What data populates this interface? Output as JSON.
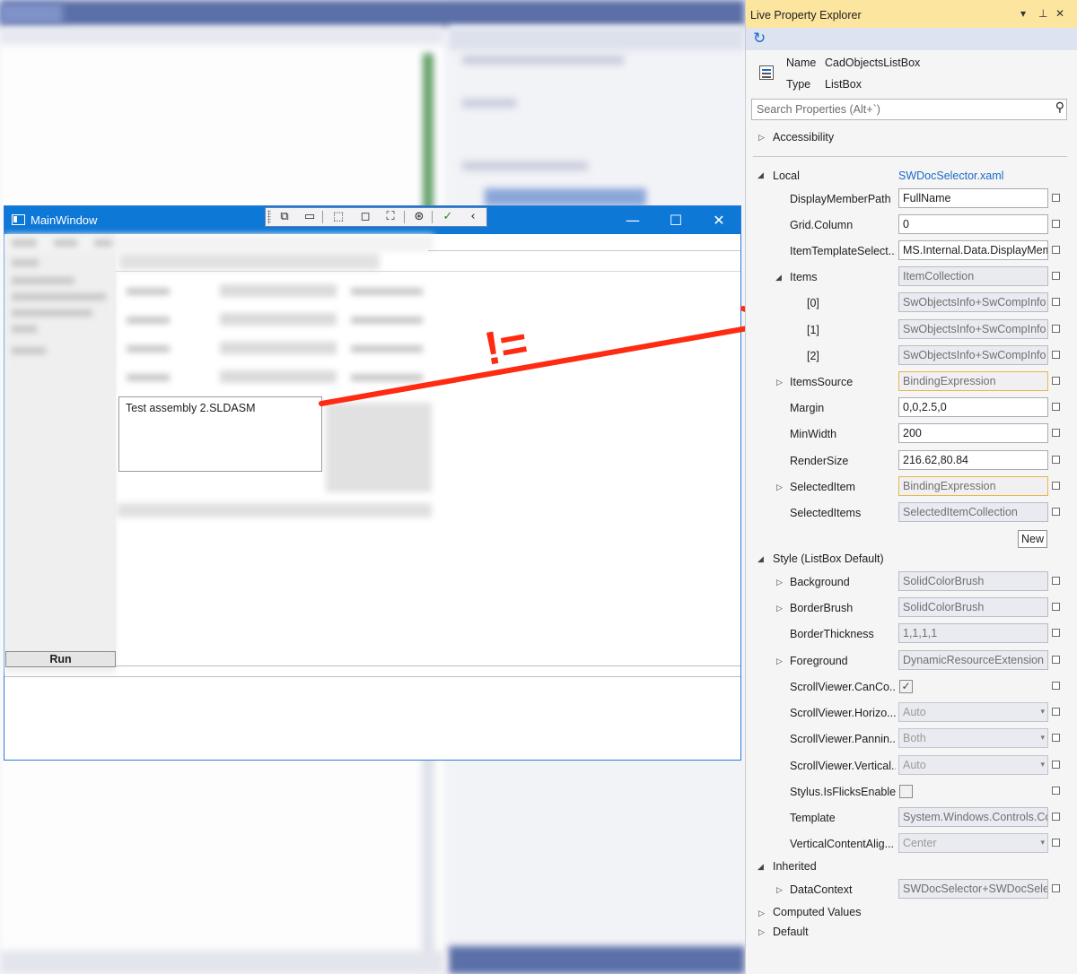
{
  "main_window": {
    "title": "MainWindow",
    "listbox_items": [
      "Test assembly 2.SLDASM"
    ],
    "run_label": "Run",
    "caption_buttons": {
      "minimize": "—",
      "maximize": "☐",
      "close": "✕"
    },
    "toolbar_icons": [
      "select-element-icon",
      "display-adorners-icon",
      "select-icon",
      "layout-adorner-icon",
      "track-focus-icon",
      "binding-failures-icon",
      "hot-reload-ok-icon",
      "collapse-icon"
    ]
  },
  "annotation": {
    "text": "!=",
    "color": "#ff2a12"
  },
  "live_property_explorer": {
    "title": "Live Property Explorer",
    "title_buttons": {
      "dropdown": "▾",
      "pin": "⊥",
      "close": "✕"
    },
    "header": {
      "name_label": "Name",
      "name_value": "CadObjectsListBox",
      "type_label": "Type",
      "type_value": "ListBox"
    },
    "search_placeholder": "Search Properties (Alt+`)",
    "sections": {
      "accessibility": "Accessibility",
      "local": "Local",
      "local_source": "SWDocSelector.xaml",
      "style": "Style (ListBox Default)",
      "inherited": "Inherited",
      "computed": "Computed Values",
      "default": "Default"
    },
    "local_props": [
      {
        "label": "DisplayMemberPath",
        "value": "FullName"
      },
      {
        "label": "Grid.Column",
        "value": "0"
      },
      {
        "label": "ItemTemplateSelect...",
        "value": "MS.Internal.Data.DisplayMemberTemplateSelector"
      },
      {
        "label": "Items",
        "value": "ItemCollection"
      },
      {
        "label": "[0]",
        "value": "SwObjectsInfo+SwCompInfo"
      },
      {
        "label": "[1]",
        "value": "SwObjectsInfo+SwCompInfo"
      },
      {
        "label": "[2]",
        "value": "SwObjectsInfo+SwCompInfo"
      },
      {
        "label": "ItemsSource",
        "value": "BindingExpression"
      },
      {
        "label": "Margin",
        "value": "0,0,2.5,0"
      },
      {
        "label": "MinWidth",
        "value": "200"
      },
      {
        "label": "RenderSize",
        "value": "216.62,80.84"
      },
      {
        "label": "SelectedItem",
        "value": "BindingExpression"
      },
      {
        "label": "SelectedItems",
        "value": "SelectedItemCollection"
      }
    ],
    "new_button": "New",
    "style_props": [
      {
        "label": "Background",
        "value": "SolidColorBrush"
      },
      {
        "label": "BorderBrush",
        "value": "SolidColorBrush"
      },
      {
        "label": "BorderThickness",
        "value": "1,1,1,1"
      },
      {
        "label": "Foreground",
        "value": "DynamicResourceExtension"
      },
      {
        "label": "ScrollViewer.CanCo...",
        "value": "",
        "checked": true
      },
      {
        "label": "ScrollViewer.Horizo...",
        "value": "Auto"
      },
      {
        "label": "ScrollViewer.Pannin...",
        "value": "Both"
      },
      {
        "label": "ScrollViewer.Vertical...",
        "value": "Auto"
      },
      {
        "label": "Stylus.IsFlicksEnabled",
        "value": "",
        "checked": false
      },
      {
        "label": "Template",
        "value": "System.Windows.Controls.ControlTemplate"
      },
      {
        "label": "VerticalContentAlig...",
        "value": "Center"
      }
    ],
    "inherited_props": [
      {
        "label": "DataContext",
        "value": "SWDocSelector+SWDocSelectorVM"
      }
    ],
    "colors": {
      "title_bar": "#fce59f",
      "link": "#1b6ac9",
      "binding_border": "#e8b64a"
    }
  }
}
